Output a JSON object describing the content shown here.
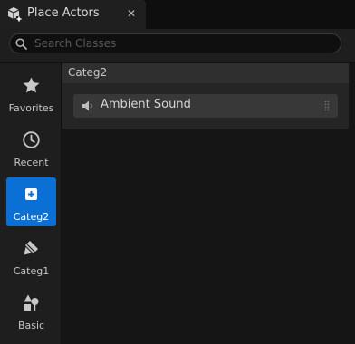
{
  "tab": {
    "title": "Place Actors",
    "close_glyph": "✕",
    "icon": "place-actors-icon"
  },
  "search": {
    "placeholder": "Search Classes",
    "icon": "search-icon"
  },
  "sidebar": {
    "items": [
      {
        "label": "Favorites",
        "icon": "star-icon",
        "active": false
      },
      {
        "label": "Recent",
        "icon": "clock-icon",
        "active": false
      },
      {
        "label": "Categ2",
        "icon": "plus-square-icon",
        "active": true
      },
      {
        "label": "Categ1",
        "icon": "paint-brush-icon",
        "active": false
      },
      {
        "label": "Basic",
        "icon": "shapes-icon",
        "active": false
      }
    ]
  },
  "category": {
    "title": "Categ2",
    "items": [
      {
        "label": "Ambient Sound",
        "icon": "speaker-icon"
      }
    ]
  },
  "colors": {
    "accent": "#0b70d6",
    "background": "#151515",
    "panel": "#1e1e1e"
  }
}
